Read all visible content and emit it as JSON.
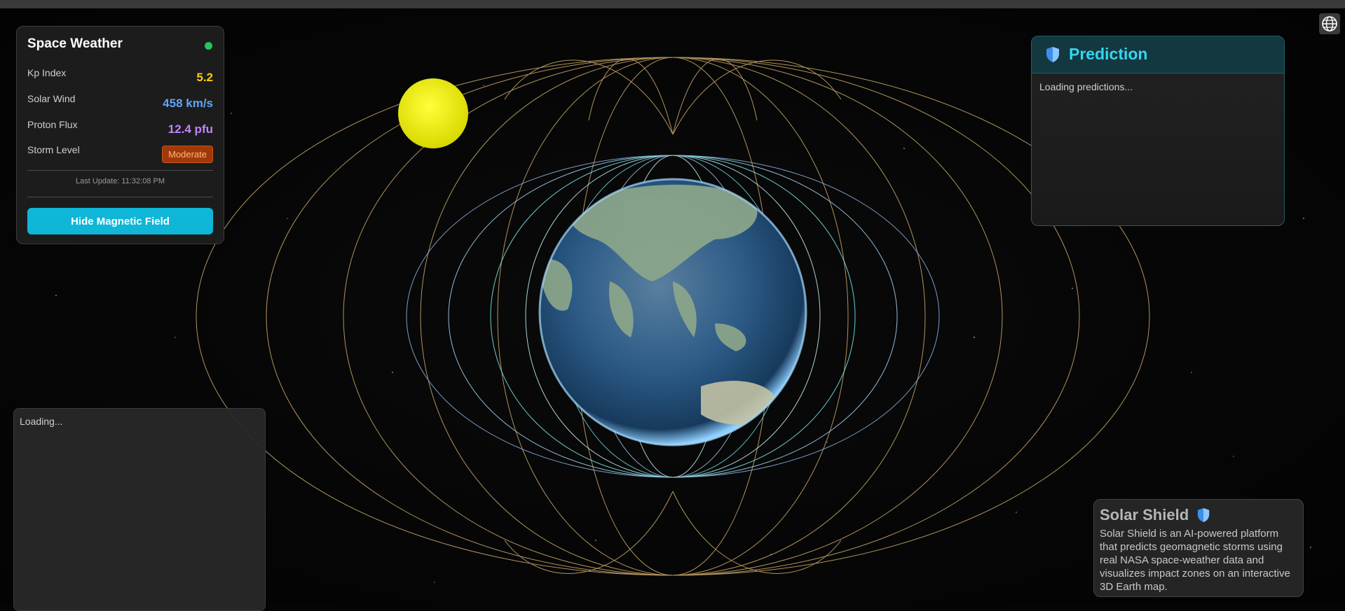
{
  "weather": {
    "title": "Space Weather",
    "kp_label": "Kp Index",
    "kp_value": "5.2",
    "wind_label": "Solar Wind",
    "wind_value": "458 km/s",
    "proton_label": "Proton Flux",
    "proton_value": "12.4 pfu",
    "storm_label": "Storm Level",
    "storm_value": "Moderate",
    "last_update": "Last Update: 11:32:08 PM",
    "toggle_label": "Hide Magnetic Field",
    "status_color": "#22c55e"
  },
  "loading_panel": {
    "text": "Loading..."
  },
  "prediction": {
    "title": "Prediction",
    "body": "Loading predictions..."
  },
  "about": {
    "title": "Solar Shield",
    "text": "Solar Shield is an AI-powered platform that predicts geomagnetic storms using real NASA space-weather data and visualizes impact zones on an interactive 3D Earth map."
  },
  "colors": {
    "kp": "#facc15",
    "wind": "#60a5fa",
    "proton": "#c084fc",
    "accent": "#0fb6d8",
    "sun": "#f5f500"
  },
  "icons": {
    "globe": "globe-icon",
    "shield": "shield-icon",
    "status": "status-dot-icon"
  }
}
